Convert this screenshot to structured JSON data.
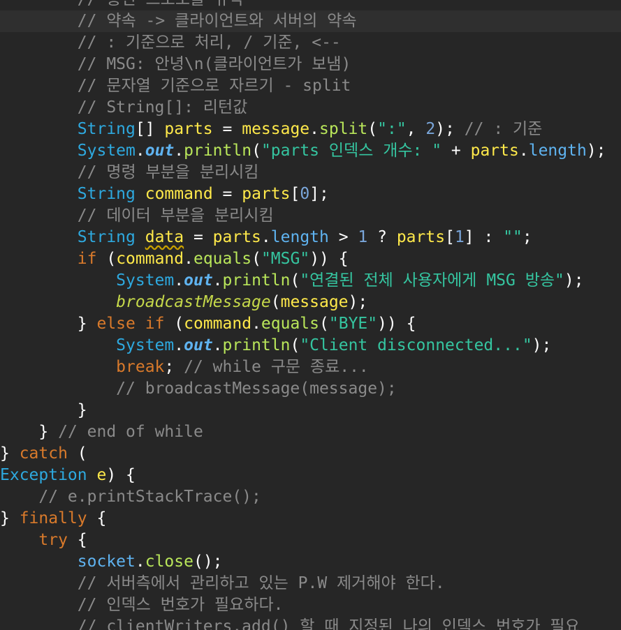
{
  "lines": [
    {
      "indent": "        ",
      "tokens": [
        {
          "t": "// ",
          "c": "comment"
        },
        {
          "t": "통신 프로토콜 규약",
          "c": "comment"
        }
      ]
    },
    {
      "indent": "        ",
      "tokens": [
        {
          "t": "// 약속 -> 클라이언트와 서버의 약속",
          "c": "comment"
        }
      ]
    },
    {
      "indent": "        ",
      "tokens": [
        {
          "t": "// : 기준으로 처리, / 기준, <--",
          "c": "comment"
        }
      ]
    },
    {
      "indent": "        ",
      "tokens": [
        {
          "t": "// MSG: 안녕\\n(클라이언트가 보냄)",
          "c": "comment"
        }
      ]
    },
    {
      "indent": "        ",
      "tokens": [
        {
          "t": "// 문자열 기준으로 자르기 - split",
          "c": "comment"
        }
      ]
    },
    {
      "indent": "        ",
      "tokens": [
        {
          "t": "// String[]: 리턴값",
          "c": "comment"
        }
      ]
    },
    {
      "indent": "        ",
      "tokens": [
        {
          "t": "String",
          "c": "type"
        },
        {
          "t": "[] ",
          "c": "plain"
        },
        {
          "t": "parts",
          "c": "var"
        },
        {
          "t": " = ",
          "c": "plain"
        },
        {
          "t": "message",
          "c": "var"
        },
        {
          "t": ".",
          "c": "plain"
        },
        {
          "t": "split",
          "c": "method"
        },
        {
          "t": "(",
          "c": "plain"
        },
        {
          "t": "\":\"",
          "c": "string"
        },
        {
          "t": ", ",
          "c": "plain"
        },
        {
          "t": "2",
          "c": "number"
        },
        {
          "t": "); ",
          "c": "plain"
        },
        {
          "t": "// : 기준",
          "c": "comment"
        }
      ]
    },
    {
      "indent": "        ",
      "tokens": [
        {
          "t": "System",
          "c": "type"
        },
        {
          "t": ".",
          "c": "plain"
        },
        {
          "t": "out",
          "c": "static"
        },
        {
          "t": ".",
          "c": "plain"
        },
        {
          "t": "println",
          "c": "method"
        },
        {
          "t": "(",
          "c": "plain"
        },
        {
          "t": "\"parts 인덱스 개수: \"",
          "c": "string"
        },
        {
          "t": " + ",
          "c": "plain"
        },
        {
          "t": "parts",
          "c": "var"
        },
        {
          "t": ".",
          "c": "plain"
        },
        {
          "t": "length",
          "c": "field"
        },
        {
          "t": ");",
          "c": "plain"
        }
      ]
    },
    {
      "indent": "        ",
      "tokens": [
        {
          "t": "// 명령 부분을 분리시킴",
          "c": "comment"
        }
      ]
    },
    {
      "indent": "        ",
      "tokens": [
        {
          "t": "String",
          "c": "type"
        },
        {
          "t": " ",
          "c": "plain"
        },
        {
          "t": "command",
          "c": "var"
        },
        {
          "t": " = ",
          "c": "plain"
        },
        {
          "t": "parts",
          "c": "var"
        },
        {
          "t": "[",
          "c": "plain"
        },
        {
          "t": "0",
          "c": "number"
        },
        {
          "t": "];",
          "c": "plain"
        }
      ]
    },
    {
      "indent": "        ",
      "tokens": [
        {
          "t": "// 데이터 부분을 분리시킴",
          "c": "comment"
        }
      ]
    },
    {
      "indent": "        ",
      "tokens": [
        {
          "t": "String",
          "c": "type"
        },
        {
          "t": " ",
          "c": "plain"
        },
        {
          "t": "data",
          "c": "var",
          "sq": true
        },
        {
          "t": " = ",
          "c": "plain"
        },
        {
          "t": "parts",
          "c": "var"
        },
        {
          "t": ".",
          "c": "plain"
        },
        {
          "t": "length",
          "c": "field"
        },
        {
          "t": " > ",
          "c": "plain"
        },
        {
          "t": "1",
          "c": "number"
        },
        {
          "t": " ? ",
          "c": "plain"
        },
        {
          "t": "parts",
          "c": "var"
        },
        {
          "t": "[",
          "c": "plain"
        },
        {
          "t": "1",
          "c": "number"
        },
        {
          "t": "] : ",
          "c": "plain"
        },
        {
          "t": "\"\"",
          "c": "string"
        },
        {
          "t": ";",
          "c": "plain"
        }
      ]
    },
    {
      "indent": "        ",
      "tokens": [
        {
          "t": "if",
          "c": "keyword"
        },
        {
          "t": " (",
          "c": "plain"
        },
        {
          "t": "command",
          "c": "var"
        },
        {
          "t": ".",
          "c": "plain"
        },
        {
          "t": "equals",
          "c": "method"
        },
        {
          "t": "(",
          "c": "plain"
        },
        {
          "t": "\"MSG\"",
          "c": "string"
        },
        {
          "t": ")) {",
          "c": "plain"
        }
      ]
    },
    {
      "indent": "            ",
      "tokens": [
        {
          "t": "System",
          "c": "type"
        },
        {
          "t": ".",
          "c": "plain"
        },
        {
          "t": "out",
          "c": "static"
        },
        {
          "t": ".",
          "c": "plain"
        },
        {
          "t": "println",
          "c": "method"
        },
        {
          "t": "(",
          "c": "plain"
        },
        {
          "t": "\"연결된 전체 사용자에게 MSG 방송\"",
          "c": "string"
        },
        {
          "t": ");",
          "c": "plain"
        }
      ]
    },
    {
      "indent": "            ",
      "tokens": [
        {
          "t": "broadcastMessage",
          "c": "italic-call"
        },
        {
          "t": "(",
          "c": "plain"
        },
        {
          "t": "message",
          "c": "var"
        },
        {
          "t": ");",
          "c": "plain"
        }
      ]
    },
    {
      "indent": "        ",
      "tokens": [
        {
          "t": "} ",
          "c": "plain"
        },
        {
          "t": "else if",
          "c": "keyword"
        },
        {
          "t": " (",
          "c": "plain"
        },
        {
          "t": "command",
          "c": "var"
        },
        {
          "t": ".",
          "c": "plain"
        },
        {
          "t": "equals",
          "c": "method"
        },
        {
          "t": "(",
          "c": "plain"
        },
        {
          "t": "\"BYE\"",
          "c": "string"
        },
        {
          "t": ")) {",
          "c": "plain"
        }
      ]
    },
    {
      "indent": "            ",
      "tokens": [
        {
          "t": "System",
          "c": "type"
        },
        {
          "t": ".",
          "c": "plain"
        },
        {
          "t": "out",
          "c": "static"
        },
        {
          "t": ".",
          "c": "plain"
        },
        {
          "t": "println",
          "c": "method"
        },
        {
          "t": "(",
          "c": "plain"
        },
        {
          "t": "\"Client disconnected...\"",
          "c": "string"
        },
        {
          "t": ");",
          "c": "plain"
        }
      ]
    },
    {
      "indent": "            ",
      "tokens": [
        {
          "t": "break",
          "c": "keyword"
        },
        {
          "t": "; ",
          "c": "plain"
        },
        {
          "t": "// while 구문 종료...",
          "c": "comment"
        }
      ]
    },
    {
      "indent": "            ",
      "tokens": [
        {
          "t": "// broadcastMessage(message);",
          "c": "comment"
        }
      ]
    },
    {
      "indent": "        ",
      "tokens": [
        {
          "t": "}",
          "c": "plain"
        }
      ]
    },
    {
      "indent": "    ",
      "tokens": [
        {
          "t": "} ",
          "c": "plain"
        },
        {
          "t": "// end of while",
          "c": "comment"
        }
      ]
    },
    {
      "indent": "",
      "tokens": [
        {
          "t": "} ",
          "c": "plain"
        },
        {
          "t": "catch",
          "c": "keyword"
        },
        {
          "t": " (",
          "c": "plain"
        }
      ]
    },
    {
      "indent": "",
      "tokens": [
        {
          "t": "Exception",
          "c": "type"
        },
        {
          "t": " ",
          "c": "plain"
        },
        {
          "t": "e",
          "c": "var"
        },
        {
          "t": ") {",
          "c": "plain"
        }
      ]
    },
    {
      "indent": "    ",
      "tokens": [
        {
          "t": "// e.printStackTrace();",
          "c": "comment"
        }
      ]
    },
    {
      "indent": "",
      "tokens": [
        {
          "t": "} ",
          "c": "plain"
        },
        {
          "t": "finally",
          "c": "keyword"
        },
        {
          "t": " {",
          "c": "plain"
        }
      ]
    },
    {
      "indent": "    ",
      "tokens": [
        {
          "t": "try",
          "c": "keyword"
        },
        {
          "t": " {",
          "c": "plain"
        }
      ]
    },
    {
      "indent": "        ",
      "tokens": [
        {
          "t": "socket",
          "c": "field"
        },
        {
          "t": ".",
          "c": "plain"
        },
        {
          "t": "close",
          "c": "method"
        },
        {
          "t": "();",
          "c": "plain"
        }
      ]
    },
    {
      "indent": "        ",
      "tokens": [
        {
          "t": "// 서버측에서 관리하고 있는 P.W 제거해야 한다.",
          "c": "comment"
        }
      ]
    },
    {
      "indent": "        ",
      "tokens": [
        {
          "t": "// 인덱스 번호가 필요하다.",
          "c": "comment"
        }
      ]
    },
    {
      "indent": "        ",
      "tokens": [
        {
          "t": "// clientWriters.add() 할 때 지정된 나의 인덱스 번호가 필요",
          "c": "comment"
        }
      ]
    }
  ]
}
